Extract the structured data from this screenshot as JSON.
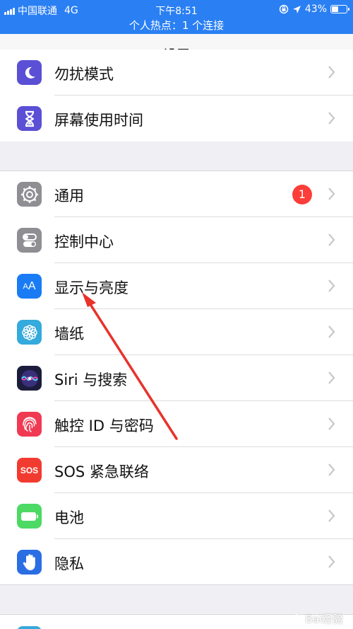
{
  "status_bar": {
    "carrier": "中国联通",
    "network": "4G",
    "time": "下午8:51",
    "battery": "43%",
    "battery_level": 0.43,
    "hotspot": "个人热点：1 个连接"
  },
  "nav": {
    "title": "设置"
  },
  "group_top": [
    {
      "label": "勿扰模式",
      "icon": "moon-icon",
      "color": "#5b4fd6"
    },
    {
      "label": "屏幕使用时间",
      "icon": "hourglass-icon",
      "color": "#5b4fd6"
    }
  ],
  "group_main": [
    {
      "label": "通用",
      "icon": "gear-icon",
      "color": "#8e8e93",
      "badge": "1"
    },
    {
      "label": "控制中心",
      "icon": "toggles-icon",
      "color": "#8e8e93"
    },
    {
      "label": "显示与亮度",
      "icon": "text-size-icon",
      "color": "#1a7cf5"
    },
    {
      "label": "墙纸",
      "icon": "flower-icon",
      "color": "#35aadc"
    },
    {
      "label": "Siri 与搜索",
      "icon": "siri-icon",
      "color": "#1c1c3c"
    },
    {
      "label": "触控 ID 与密码",
      "icon": "fingerprint-icon",
      "color": "#f03a52"
    },
    {
      "label": "SOS 紧急联络",
      "icon": "sos-icon",
      "color": "#f23b30",
      "icon_text": "SOS"
    },
    {
      "label": "电池",
      "icon": "battery-icon",
      "color": "#4cd964"
    },
    {
      "label": "隐私",
      "icon": "hand-icon",
      "color": "#2b6ee4"
    }
  ],
  "watermark": "Bai经验"
}
